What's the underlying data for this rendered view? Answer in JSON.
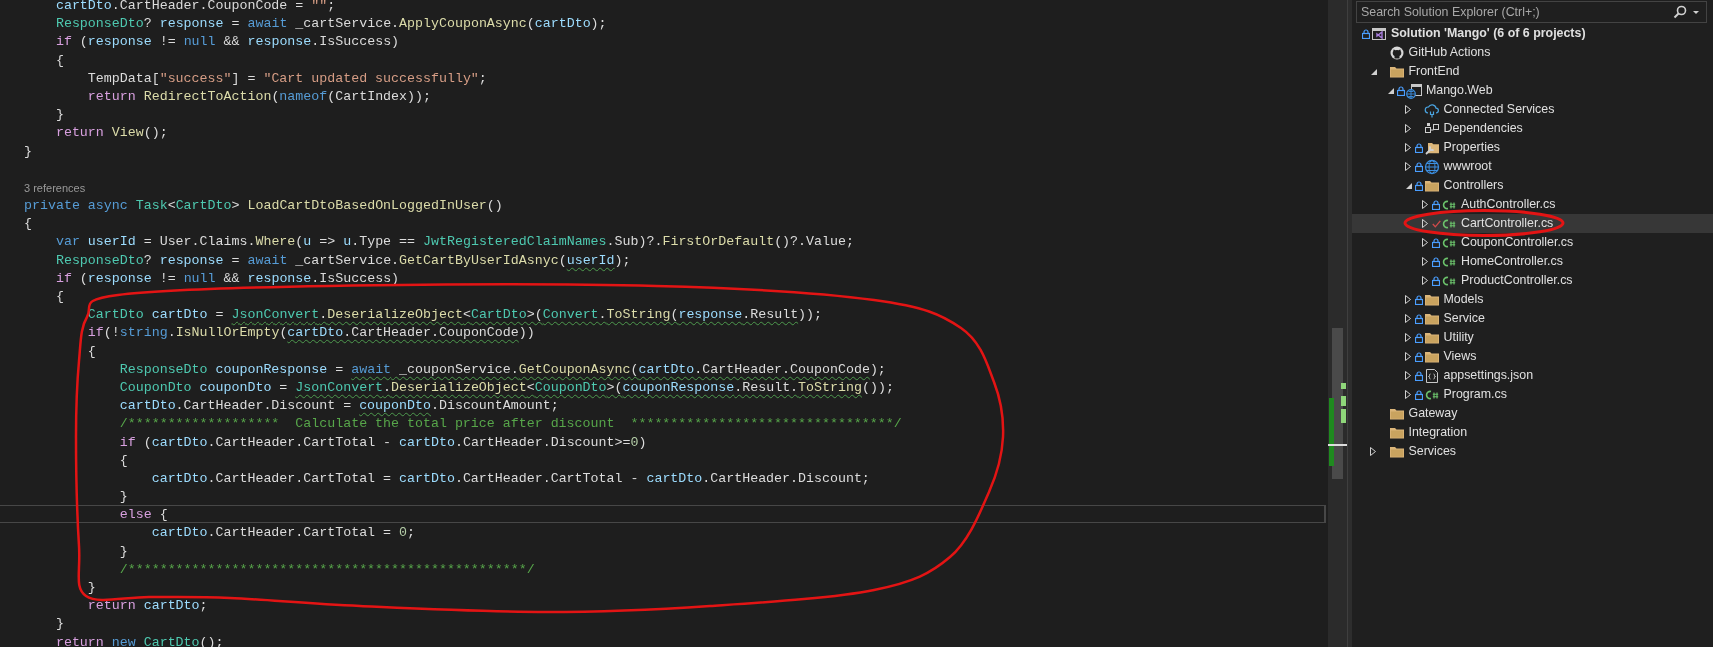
{
  "editor": {
    "lines": [
      {
        "kind": "code",
        "current": false,
        "tokens": [
          {
            "text": "    cartDto",
            "kind": "v"
          },
          {
            "text": ".CartHeader.CouponCode = ",
            "kind": "p"
          },
          {
            "text": "\"\"",
            "kind": "s"
          },
          {
            "text": ";",
            "kind": "p"
          }
        ]
      },
      {
        "kind": "code",
        "current": false,
        "tokens": [
          {
            "text": "    ResponseDto",
            "kind": "t"
          },
          {
            "text": "? ",
            "kind": "p"
          },
          {
            "text": "response",
            "kind": "v"
          },
          {
            "text": " = ",
            "kind": "p"
          },
          {
            "text": "await",
            "kind": "k"
          },
          {
            "text": " _cartService.",
            "kind": "p"
          },
          {
            "text": "ApplyCouponAsync",
            "kind": "m"
          },
          {
            "text": "(",
            "kind": "p"
          },
          {
            "text": "cartDto",
            "kind": "v"
          },
          {
            "text": ");",
            "kind": "p"
          }
        ]
      },
      {
        "kind": "code",
        "current": false,
        "tokens": [
          {
            "text": "    if",
            "kind": "c"
          },
          {
            "text": " (",
            "kind": "p"
          },
          {
            "text": "response",
            "kind": "v"
          },
          {
            "text": " != ",
            "kind": "p"
          },
          {
            "text": "null",
            "kind": "k"
          },
          {
            "text": " && ",
            "kind": "p"
          },
          {
            "text": "response",
            "kind": "v"
          },
          {
            "text": ".IsSuccess)",
            "kind": "p"
          }
        ]
      },
      {
        "kind": "code",
        "current": false,
        "tokens": [
          {
            "text": "    {",
            "kind": "p"
          }
        ]
      },
      {
        "kind": "code",
        "current": false,
        "tokens": [
          {
            "text": "        TempData[",
            "kind": "p"
          },
          {
            "text": "\"success\"",
            "kind": "s"
          },
          {
            "text": "] = ",
            "kind": "p"
          },
          {
            "text": "\"Cart updated successfully\"",
            "kind": "s"
          },
          {
            "text": ";",
            "kind": "p"
          }
        ]
      },
      {
        "kind": "code",
        "current": false,
        "tokens": [
          {
            "text": "        return",
            "kind": "c"
          },
          {
            "text": " RedirectToAction",
            "kind": "m"
          },
          {
            "text": "(",
            "kind": "p"
          },
          {
            "text": "nameof",
            "kind": "k"
          },
          {
            "text": "(CartIndex));",
            "kind": "p"
          }
        ]
      },
      {
        "kind": "code",
        "current": false,
        "tokens": [
          {
            "text": "    }",
            "kind": "p"
          }
        ]
      },
      {
        "kind": "code",
        "current": false,
        "tokens": [
          {
            "text": "    return",
            "kind": "c"
          },
          {
            "text": " View",
            "kind": "m"
          },
          {
            "text": "();",
            "kind": "p"
          }
        ]
      },
      {
        "kind": "code",
        "current": false,
        "tokens": [
          {
            "text": "}",
            "kind": "p"
          }
        ]
      },
      {
        "kind": "blank"
      },
      {
        "kind": "codelens",
        "text": "3 references"
      },
      {
        "kind": "code",
        "current": false,
        "tokens": [
          {
            "text": "private",
            "kind": "k"
          },
          {
            "text": " async",
            "kind": "k"
          },
          {
            "text": " Task",
            "kind": "t"
          },
          {
            "text": "<",
            "kind": "p"
          },
          {
            "text": "CartDto",
            "kind": "t"
          },
          {
            "text": "> ",
            "kind": "p"
          },
          {
            "text": "LoadCartDtoBasedOnLoggedInUser",
            "kind": "m"
          },
          {
            "text": "()",
            "kind": "p"
          }
        ]
      },
      {
        "kind": "code",
        "current": false,
        "tokens": [
          {
            "text": "{",
            "kind": "p"
          }
        ]
      },
      {
        "kind": "code",
        "current": false,
        "tokens": [
          {
            "text": "    var",
            "kind": "k"
          },
          {
            "text": " userId",
            "kind": "v"
          },
          {
            "text": " = User.Claims.",
            "kind": "p"
          },
          {
            "text": "Where",
            "kind": "m"
          },
          {
            "text": "(",
            "kind": "p"
          },
          {
            "text": "u",
            "kind": "v"
          },
          {
            "text": " => ",
            "kind": "p"
          },
          {
            "text": "u",
            "kind": "v"
          },
          {
            "text": ".Type == ",
            "kind": "p"
          },
          {
            "text": "JwtRegisteredClaimNames",
            "kind": "t"
          },
          {
            "text": ".Sub)?.",
            "kind": "p"
          },
          {
            "text": "FirstOrDefault",
            "kind": "m"
          },
          {
            "text": "()?.Value;",
            "kind": "p"
          }
        ]
      },
      {
        "kind": "code",
        "current": false,
        "tokens": [
          {
            "text": "    ResponseDto",
            "kind": "t"
          },
          {
            "text": "? ",
            "kind": "p"
          },
          {
            "text": "response",
            "kind": "v"
          },
          {
            "text": " = ",
            "kind": "p"
          },
          {
            "text": "await",
            "kind": "k"
          },
          {
            "text": " _cartService.",
            "kind": "p"
          },
          {
            "text": "GetCartByUserIdAsnyc",
            "kind": "m"
          },
          {
            "text": "(",
            "kind": "p"
          },
          {
            "text": "userId",
            "kind": "v",
            "squiggle": true
          },
          {
            "text": ");",
            "kind": "p"
          }
        ]
      },
      {
        "kind": "code",
        "current": false,
        "tokens": [
          {
            "text": "    if",
            "kind": "c"
          },
          {
            "text": " (",
            "kind": "p"
          },
          {
            "text": "response",
            "kind": "v"
          },
          {
            "text": " != ",
            "kind": "p"
          },
          {
            "text": "null",
            "kind": "k"
          },
          {
            "text": " && ",
            "kind": "p"
          },
          {
            "text": "response",
            "kind": "v"
          },
          {
            "text": ".IsSuccess)",
            "kind": "p"
          }
        ]
      },
      {
        "kind": "code",
        "current": false,
        "tokens": [
          {
            "text": "    {",
            "kind": "p"
          }
        ]
      },
      {
        "kind": "code",
        "current": false,
        "tokens": [
          {
            "text": "        CartDto",
            "kind": "t"
          },
          {
            "text": " cartDto",
            "kind": "v"
          },
          {
            "text": " = ",
            "kind": "p"
          },
          {
            "text": "JsonConvert",
            "kind": "t",
            "squiggle": true
          },
          {
            "text": ".",
            "kind": "p",
            "squiggle": true
          },
          {
            "text": "DeserializeObject",
            "kind": "m",
            "squiggle": true
          },
          {
            "text": "<",
            "kind": "p",
            "squiggle": true
          },
          {
            "text": "CartDto",
            "kind": "t",
            "squiggle": true
          },
          {
            "text": ">(",
            "kind": "p",
            "squiggle": true
          },
          {
            "text": "Convert",
            "kind": "t",
            "squiggle": true
          },
          {
            "text": ".",
            "kind": "p",
            "squiggle": true
          },
          {
            "text": "ToString",
            "kind": "m",
            "squiggle": true
          },
          {
            "text": "(",
            "kind": "p",
            "squiggle": true
          },
          {
            "text": "response",
            "kind": "v",
            "squiggle": true
          },
          {
            "text": ".Result",
            "kind": "p",
            "squiggle": true
          },
          {
            "text": "));",
            "kind": "p"
          }
        ]
      },
      {
        "kind": "code",
        "current": false,
        "tokens": [
          {
            "text": "        if",
            "kind": "c"
          },
          {
            "text": "(!",
            "kind": "p"
          },
          {
            "text": "string",
            "kind": "k"
          },
          {
            "text": ".",
            "kind": "p"
          },
          {
            "text": "IsNullOrEmpty",
            "kind": "m"
          },
          {
            "text": "(",
            "kind": "p"
          },
          {
            "text": "cartDto",
            "kind": "v",
            "squiggle": true
          },
          {
            "text": ".CartHeader.CouponCode",
            "kind": "p",
            "squiggle": true
          },
          {
            "text": "))",
            "kind": "p"
          }
        ]
      },
      {
        "kind": "code",
        "current": false,
        "tokens": [
          {
            "text": "        {",
            "kind": "p"
          }
        ]
      },
      {
        "kind": "code",
        "current": false,
        "tokens": [
          {
            "text": "            ResponseDto",
            "kind": "t"
          },
          {
            "text": " couponResponse",
            "kind": "v"
          },
          {
            "text": " = ",
            "kind": "p"
          },
          {
            "text": "await",
            "kind": "k",
            "squiggle": true
          },
          {
            "text": " _couponService.",
            "kind": "p",
            "squiggle": true
          },
          {
            "text": "GetCouponAsync",
            "kind": "m",
            "squiggle": true
          },
          {
            "text": "(",
            "kind": "p",
            "squiggle": true
          },
          {
            "text": "cartDto",
            "kind": "v",
            "squiggle": true
          },
          {
            "text": ".CartHeader.CouponCode",
            "kind": "p",
            "squiggle": true
          },
          {
            "text": ");",
            "kind": "p"
          }
        ]
      },
      {
        "kind": "code",
        "current": false,
        "tokens": [
          {
            "text": "            CouponDto",
            "kind": "t"
          },
          {
            "text": " couponDto",
            "kind": "v"
          },
          {
            "text": " = ",
            "kind": "p"
          },
          {
            "text": "JsonConvert",
            "kind": "t",
            "squiggle": true
          },
          {
            "text": ".",
            "kind": "p",
            "squiggle": true
          },
          {
            "text": "DeserializeObject",
            "kind": "m",
            "squiggle": true
          },
          {
            "text": "<",
            "kind": "p",
            "squiggle": true
          },
          {
            "text": "CouponDto",
            "kind": "t",
            "squiggle": true
          },
          {
            "text": ">(",
            "kind": "p",
            "squiggle": true
          },
          {
            "text": "couponResponse",
            "kind": "v",
            "squiggle": true
          },
          {
            "text": ".Result.",
            "kind": "p",
            "squiggle": true
          },
          {
            "text": "ToString",
            "kind": "m",
            "squiggle": true
          },
          {
            "text": "());",
            "kind": "p"
          }
        ]
      },
      {
        "kind": "code",
        "current": false,
        "tokens": [
          {
            "text": "            cartDto",
            "kind": "v"
          },
          {
            "text": ".CartHeader.Discount = ",
            "kind": "p"
          },
          {
            "text": "couponDto",
            "kind": "v",
            "squiggle": true
          },
          {
            "text": ".DiscountAmount;",
            "kind": "p"
          }
        ]
      },
      {
        "kind": "code",
        "current": false,
        "tokens": [
          {
            "text": "            /*******************  Calculate the total price after discount  *********************************/",
            "kind": "cm"
          }
        ]
      },
      {
        "kind": "code",
        "current": false,
        "tokens": [
          {
            "text": "            if",
            "kind": "c"
          },
          {
            "text": " (",
            "kind": "p"
          },
          {
            "text": "cartDto",
            "kind": "v"
          },
          {
            "text": ".CartHeader.CartTotal - ",
            "kind": "p"
          },
          {
            "text": "cartDto",
            "kind": "v"
          },
          {
            "text": ".CartHeader.Discount>=",
            "kind": "p"
          },
          {
            "text": "0",
            "kind": "n"
          },
          {
            "text": ")",
            "kind": "p"
          }
        ]
      },
      {
        "kind": "code",
        "current": false,
        "tokens": [
          {
            "text": "            {",
            "kind": "p"
          }
        ]
      },
      {
        "kind": "code",
        "current": false,
        "tokens": [
          {
            "text": "                cartDto",
            "kind": "v"
          },
          {
            "text": ".CartHeader.CartTotal = ",
            "kind": "p"
          },
          {
            "text": "cartDto",
            "kind": "v"
          },
          {
            "text": ".CartHeader.CartTotal - ",
            "kind": "p"
          },
          {
            "text": "cartDto",
            "kind": "v"
          },
          {
            "text": ".CartHeader.Discount;",
            "kind": "p"
          }
        ]
      },
      {
        "kind": "code",
        "current": false,
        "tokens": [
          {
            "text": "            }",
            "kind": "p"
          }
        ]
      },
      {
        "kind": "code",
        "current": true,
        "tokens": [
          {
            "text": "            else",
            "kind": "c"
          },
          {
            "text": " {",
            "kind": "p"
          }
        ]
      },
      {
        "kind": "code",
        "current": false,
        "tokens": [
          {
            "text": "                cartDto",
            "kind": "v"
          },
          {
            "text": ".CartHeader.CartTotal = ",
            "kind": "p"
          },
          {
            "text": "0",
            "kind": "n"
          },
          {
            "text": ";",
            "kind": "p"
          }
        ]
      },
      {
        "kind": "code",
        "current": false,
        "tokens": [
          {
            "text": "            }",
            "kind": "p"
          }
        ]
      },
      {
        "kind": "code",
        "current": false,
        "tokens": [
          {
            "text": "            /**************************************************/",
            "kind": "cm"
          }
        ]
      },
      {
        "kind": "code",
        "current": false,
        "tokens": [
          {
            "text": "        }",
            "kind": "p"
          }
        ]
      },
      {
        "kind": "code",
        "current": false,
        "tokens": [
          {
            "text": "        return",
            "kind": "c"
          },
          {
            "text": " cartDto",
            "kind": "v"
          },
          {
            "text": ";",
            "kind": "p"
          }
        ]
      },
      {
        "kind": "code",
        "current": false,
        "tokens": [
          {
            "text": "    }",
            "kind": "p"
          }
        ]
      },
      {
        "kind": "code",
        "current": false,
        "tokens": [
          {
            "text": "    return",
            "kind": "c"
          },
          {
            "text": " new",
            "kind": "k"
          },
          {
            "text": " CartDto",
            "kind": "t"
          },
          {
            "text": "();",
            "kind": "p"
          }
        ]
      }
    ]
  },
  "solution_explorer": {
    "search": {
      "placeholder": "Search Solution Explorer (Ctrl+;)"
    },
    "tree": [
      {
        "label": "Solution 'Mango' (6 of 6 projects)",
        "kind": "solution",
        "locked": true,
        "selected": false,
        "children": [
          {
            "label": "GitHub Actions",
            "kind": "github",
            "locked": false,
            "selected": false
          },
          {
            "label": "FrontEnd",
            "kind": "folder",
            "locked": false,
            "expanded": true,
            "selected": false,
            "children": [
              {
                "label": "Mango.Web",
                "kind": "web-project",
                "locked": true,
                "expanded": true,
                "selected": false,
                "children": [
                  {
                    "label": "Connected Services",
                    "kind": "connected-services",
                    "locked": false,
                    "expanded": false,
                    "selected": false
                  },
                  {
                    "label": "Dependencies",
                    "kind": "dependencies",
                    "locked": false,
                    "expanded": false,
                    "selected": false
                  },
                  {
                    "label": "Properties",
                    "kind": "properties",
                    "locked": true,
                    "expanded": false,
                    "selected": false
                  },
                  {
                    "label": "wwwroot",
                    "kind": "globe",
                    "locked": true,
                    "expanded": false,
                    "selected": false
                  },
                  {
                    "label": "Controllers",
                    "kind": "folder",
                    "locked": true,
                    "expanded": true,
                    "selected": false,
                    "children": [
                      {
                        "label": "AuthController.cs",
                        "kind": "csharp",
                        "locked": true,
                        "expanded": false,
                        "selected": false
                      },
                      {
                        "label": "CartController.cs",
                        "kind": "csharp",
                        "locked": false,
                        "edited": true,
                        "expanded": false,
                        "selected": true
                      },
                      {
                        "label": "CouponController.cs",
                        "kind": "csharp",
                        "locked": true,
                        "expanded": false,
                        "selected": false
                      },
                      {
                        "label": "HomeController.cs",
                        "kind": "csharp",
                        "locked": true,
                        "expanded": false,
                        "selected": false
                      },
                      {
                        "label": "ProductController.cs",
                        "kind": "csharp",
                        "locked": true,
                        "expanded": false,
                        "selected": false
                      }
                    ]
                  },
                  {
                    "label": "Models",
                    "kind": "folder",
                    "locked": true,
                    "expanded": false,
                    "selected": false
                  },
                  {
                    "label": "Service",
                    "kind": "folder",
                    "locked": true,
                    "expanded": false,
                    "selected": false
                  },
                  {
                    "label": "Utility",
                    "kind": "folder",
                    "locked": true,
                    "expanded": false,
                    "selected": false
                  },
                  {
                    "label": "Views",
                    "kind": "folder",
                    "locked": true,
                    "expanded": false,
                    "selected": false
                  },
                  {
                    "label": "appsettings.json",
                    "kind": "json",
                    "locked": true,
                    "expanded": false,
                    "selected": false
                  },
                  {
                    "label": "Program.cs",
                    "kind": "csharp",
                    "locked": true,
                    "expanded": false,
                    "selected": false
                  }
                ]
              }
            ]
          },
          {
            "label": "Gateway",
            "kind": "folder",
            "locked": false,
            "selected": false
          },
          {
            "label": "Integration",
            "kind": "folder",
            "locked": false,
            "selected": false
          },
          {
            "label": "Services",
            "kind": "folder",
            "locked": false,
            "expanded": false,
            "selected": false
          }
        ]
      }
    ]
  }
}
